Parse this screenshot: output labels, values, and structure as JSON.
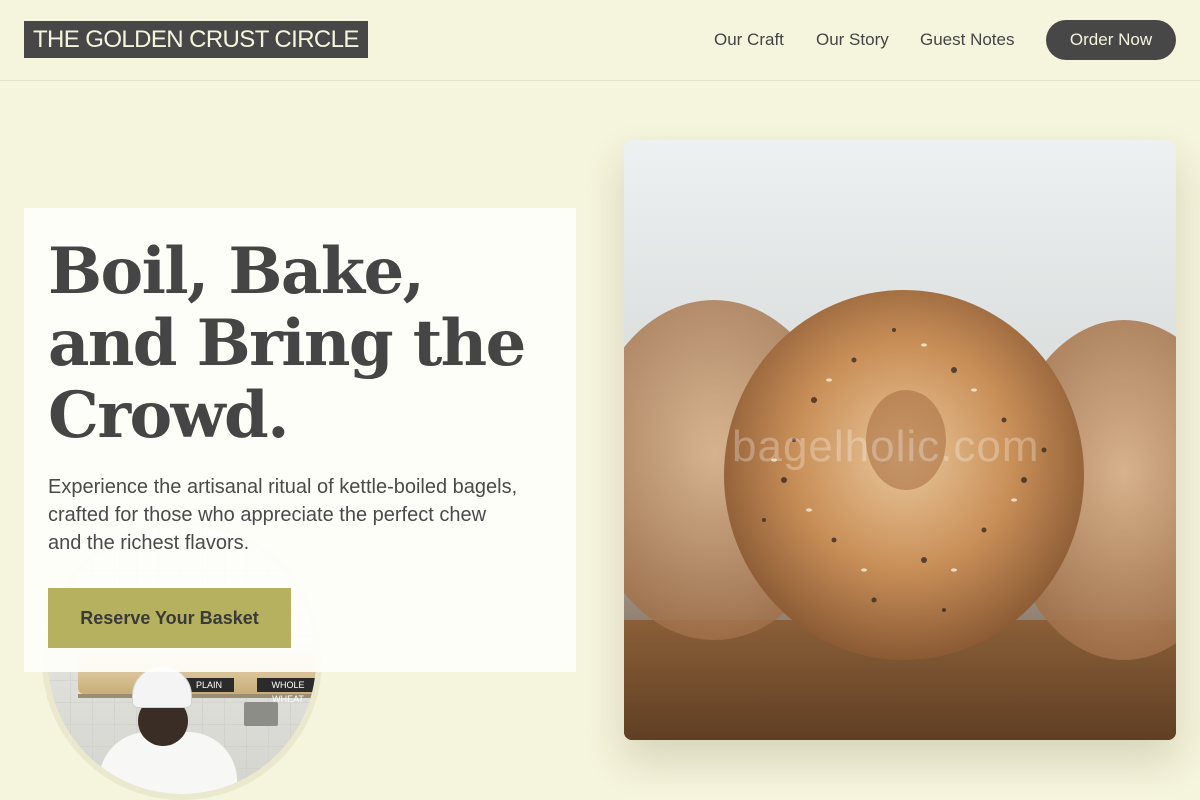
{
  "header": {
    "logo": "THE GOLDEN CRUST CIRCLE",
    "nav": [
      {
        "label": "Our Craft"
      },
      {
        "label": "Our Story"
      },
      {
        "label": "Guest Notes"
      }
    ],
    "cta": "Order Now"
  },
  "hero": {
    "title": "Boil, Bake, and Bring the Crowd.",
    "text": "Experience the artisanal ritual of kettle-boiled bagels, crafted for those who appreciate the perfect chew and the richest flavors.",
    "button": "Reserve Your Basket"
  },
  "chef_photo": {
    "sign_plain": "PLAIN",
    "sign_wheat": "WHOLE WHEAT"
  },
  "bagel_photo": {
    "watermark": "bagelholic.com"
  },
  "colors": {
    "background": "#f5f4dc",
    "accent": "#b6b15f",
    "dark": "#474747"
  }
}
